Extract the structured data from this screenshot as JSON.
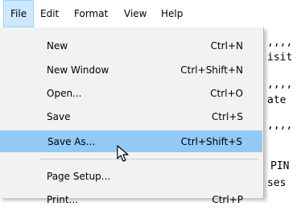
{
  "menubar": {
    "items": [
      {
        "label": "File",
        "active": true
      },
      {
        "label": "Edit"
      },
      {
        "label": "Format"
      },
      {
        "label": "View"
      },
      {
        "label": "Help"
      }
    ]
  },
  "file_menu": {
    "items": [
      {
        "label": "New",
        "shortcut": "Ctrl+N"
      },
      {
        "label": "New Window",
        "shortcut": "Ctrl+Shift+N"
      },
      {
        "label": "Open...",
        "shortcut": "Ctrl+O"
      },
      {
        "label": "Save",
        "shortcut": "Ctrl+S"
      },
      {
        "label": "Save As...",
        "shortcut": "Ctrl+Shift+S",
        "highlighted": true
      },
      {
        "label": "Page Setup...",
        "shortcut": ""
      },
      {
        "label": "Print...",
        "shortcut": "Ctrl+P"
      }
    ]
  },
  "editor": {
    "lines": [
      ",,,,",
      "isit",
      ",,,,",
      "ate ",
      ",,,,",
      "PIN",
      "ses "
    ]
  },
  "colors": {
    "menu_background": "#f2f2f2",
    "highlight": "#91c9f7",
    "menubar_active": "#cde8ff"
  },
  "icons": {
    "cursor": "arrow-pointer-icon"
  }
}
